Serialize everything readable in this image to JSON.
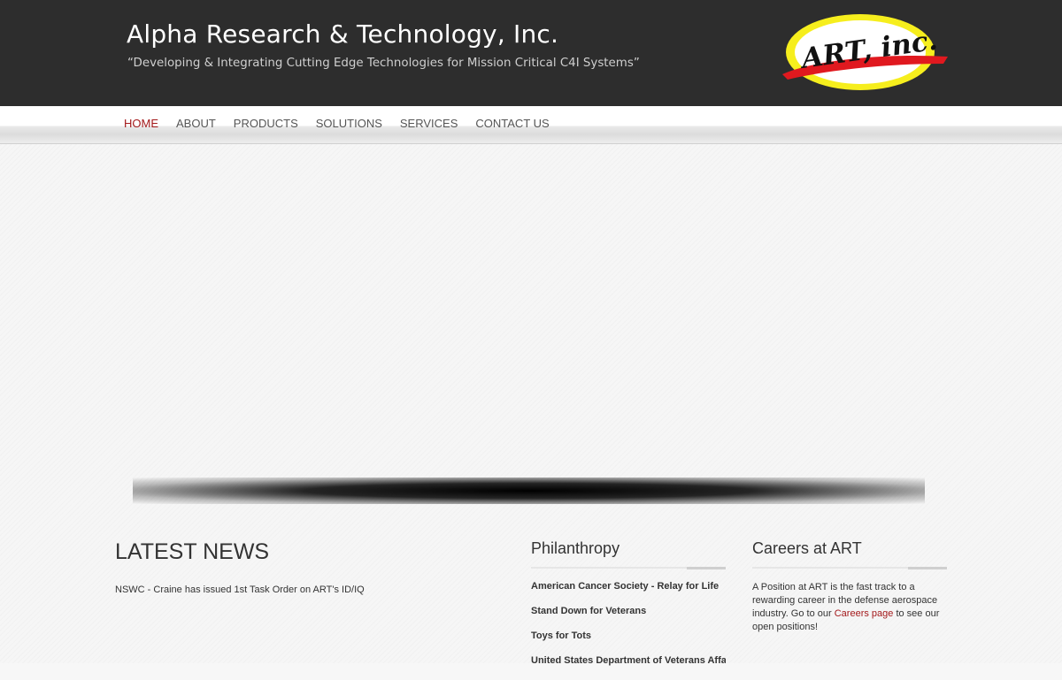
{
  "header": {
    "title": "Alpha Research & Technology, Inc.",
    "tagline": "“Developing & Integrating Cutting Edge Technologies for Mission Critical C4I Systems”",
    "logo_text": "ART, inc."
  },
  "nav": {
    "items": [
      {
        "label": "HOME",
        "active": true
      },
      {
        "label": "ABOUT"
      },
      {
        "label": "PRODUCTS"
      },
      {
        "label": "SOLUTIONS"
      },
      {
        "label": "SERVICES"
      },
      {
        "label": "CONTACT US"
      }
    ]
  },
  "news": {
    "heading": "LATEST NEWS",
    "items": [
      "NSWC - Craine has issued 1st Task Order on ART's ID/IQ"
    ]
  },
  "philanthropy": {
    "title": "Philanthropy",
    "items": [
      "American Cancer Society - Relay for Life",
      "Stand Down for Veterans",
      "Toys for Tots",
      "United States Department of Veterans Affairs"
    ]
  },
  "careers": {
    "title": "Careers at ART",
    "text_before": "A Position at ART is the fast track to a rewarding career in the defense aerospace industry. Go to our ",
    "link_text": "Careers page",
    "text_after": " to see our open positions!"
  },
  "colors": {
    "header_bg": "#2d2d2d",
    "accent_red": "#a3191b",
    "logo_yellow": "#f6ee1d",
    "logo_red": "#e0191f"
  }
}
